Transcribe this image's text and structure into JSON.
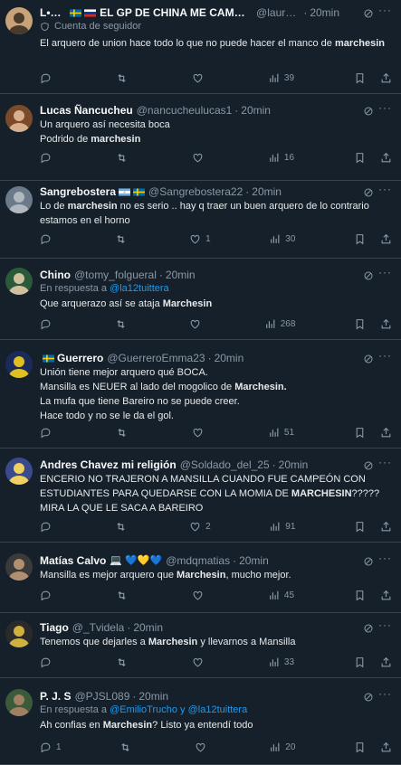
{
  "tweets": [
    {
      "name": "L•a•u•",
      "flags": [
        "se",
        "ru"
      ],
      "name_suffix": "EL GP DE CHINA ME CAMBIO L...",
      "handle": "@lauran...",
      "time": "20min",
      "follower_label": "Cuenta de seguidor",
      "body_html": "El arquero de union hace todo lo que no puede hacer el manco de <b>marchesin</b>",
      "replies": "",
      "retweets": "",
      "likes": "",
      "views": "39"
    },
    {
      "name": "Lucas Ñancucheu",
      "handle": "@nancucheulucas1",
      "time": "20min",
      "body_html": "Un arquero así necesita boca<br>Podrido de <b>marchesin</b>",
      "replies": "",
      "retweets": "",
      "likes": "",
      "views": "16"
    },
    {
      "name": "Sangrebostera",
      "flags": [
        "ar",
        "se"
      ],
      "handle": "@Sangrebostera22",
      "time": "20min",
      "body_html": "Lo de <b>marchesin</b> no es serio .. hay q traer un buen arquero de lo contrario estamos en el horno",
      "replies": "",
      "retweets": "",
      "likes": "1",
      "views": "30"
    },
    {
      "name": "Chino",
      "handle": "@tomy_folgueral",
      "time": "20min",
      "reply_prefix": "En respuesta a",
      "reply_to": "@la12tuittera",
      "body_html": "Que arquerazo así se ataja <b>Marchesin</b>",
      "replies": "",
      "retweets": "",
      "likes": "",
      "views": "268"
    },
    {
      "name": "Guerrero",
      "flags_before": [
        "se"
      ],
      "handle": "@GuerreroEmma23",
      "time": "20min",
      "body_html": "Unión tiene mejor arquero qué BOCA.<br>Mansilla es NEUER al lado del mogolico de <b>Marchesin.</b><br>La mufa que tiene Bareiro no se puede creer.<br>Hace todo y no se le da el gol.",
      "replies": "",
      "retweets": "",
      "likes": "",
      "views": "51"
    },
    {
      "name": "Andres Chavez mi religión",
      "handle": "@Soldado_del_25",
      "time": "20min",
      "body_html": "ENCERIO NO TRAJERON A MANSILLA CUANDO FUE CAMPEÓN CON ESTUDIANTES PARA QUEDARSE CON LA MOMIA DE <b>MARCHESIN</b>????? MIRA LA QUE LE SACA A BAREIRO",
      "replies": "",
      "retweets": "",
      "likes": "2",
      "views": "91"
    },
    {
      "name": "Matías Calvo",
      "emoji": "💻 💙💛💙",
      "handle": "@mdqmatias",
      "time": "20min",
      "body_html": "Mansilla es mejor arquero que <b>Marchesin</b>, mucho mejor.",
      "replies": "",
      "retweets": "",
      "likes": "",
      "views": "45"
    },
    {
      "name": "Tiago",
      "handle": "@_Tvidela",
      "time": "20min",
      "body_html": "Tenemos que dejarles a <b>Marchesin</b> y llevarnos a Mansilla",
      "replies": "",
      "retweets": "",
      "likes": "",
      "views": "33"
    },
    {
      "name": "P. J. S",
      "handle": "@PJSL089",
      "time": "20min",
      "reply_prefix": "En respuesta a",
      "reply_to": "@EmilioTrucho y @la12tuittera",
      "body_html": "Ah confias en <b>Marchesin</b>? Listo ya entendí todo",
      "replies": "1",
      "retweets": "",
      "likes": "",
      "views": "20"
    }
  ],
  "colors": {
    "background": "#15202b",
    "divider": "#38444d",
    "secondary_text": "#8b98a5",
    "link": "#1d9bf0"
  }
}
